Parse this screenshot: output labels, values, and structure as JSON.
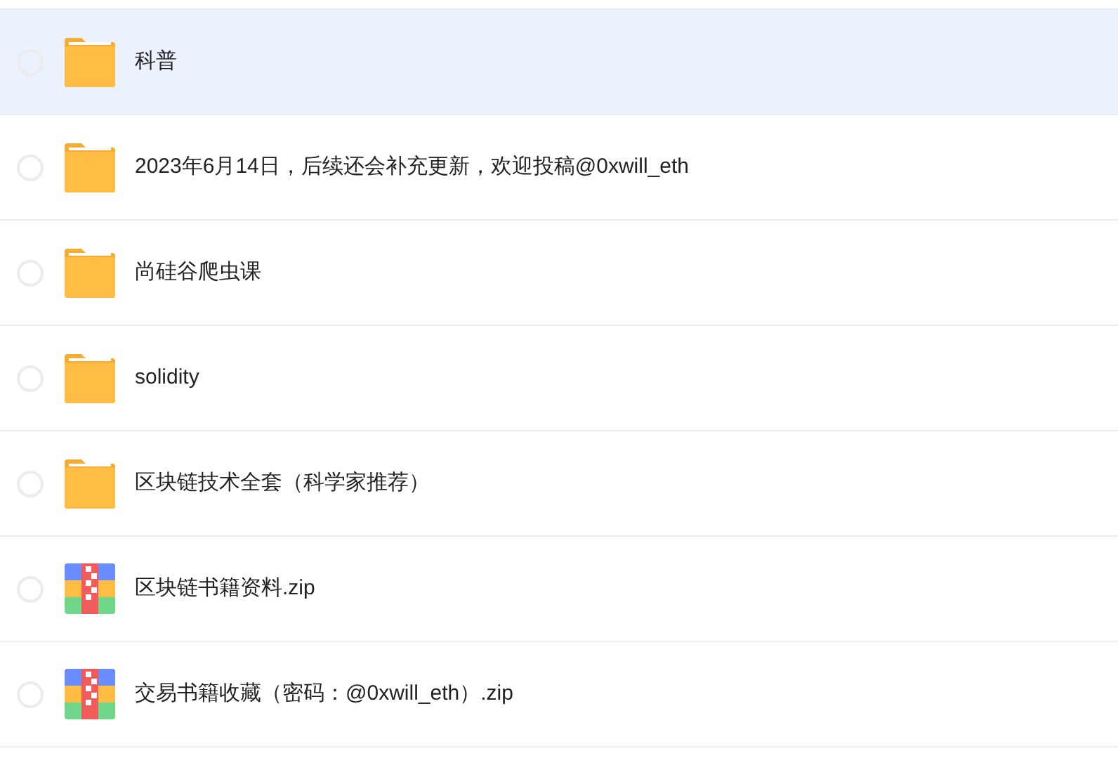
{
  "files": [
    {
      "name": "科普",
      "kind": "folder",
      "selected": true,
      "checked": false
    },
    {
      "name": "2023年6月14日，后续还会补充更新，欢迎投稿@0xwill_eth",
      "kind": "folder",
      "selected": false,
      "checked": false
    },
    {
      "name": "尚硅谷爬虫课",
      "kind": "folder",
      "selected": false,
      "checked": false
    },
    {
      "name": "solidity",
      "kind": "folder",
      "selected": false,
      "checked": false
    },
    {
      "name": "区块链技术全套（科学家推荐）",
      "kind": "folder",
      "selected": false,
      "checked": false
    },
    {
      "name": "区块链书籍资料.zip",
      "kind": "zip",
      "selected": false,
      "checked": false
    },
    {
      "name": "交易书籍收藏（密码：@0xwill_eth）.zip",
      "kind": "zip",
      "selected": false,
      "checked": false
    }
  ]
}
